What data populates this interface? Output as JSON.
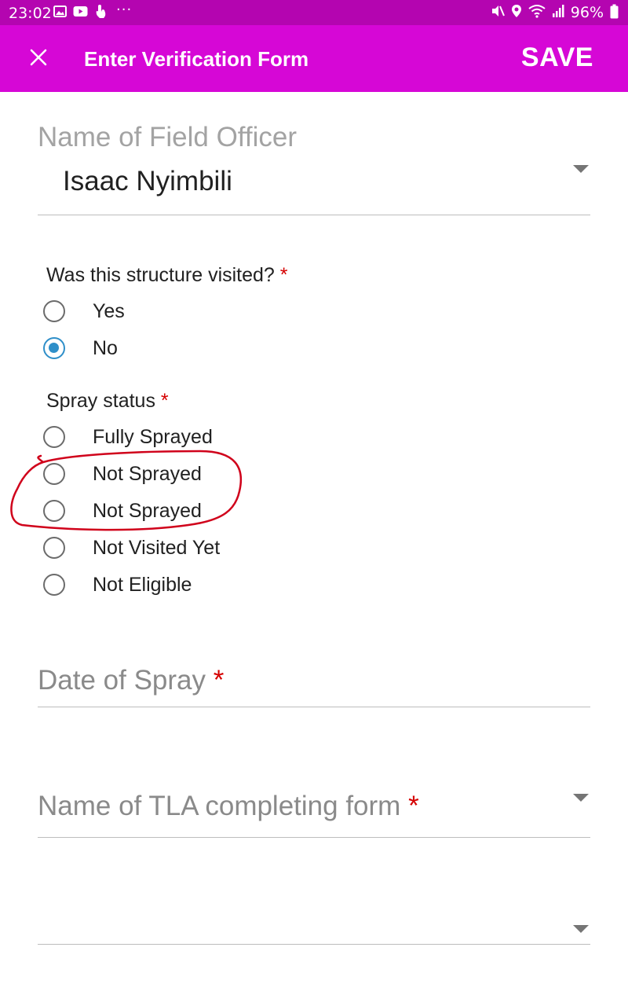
{
  "status_bar": {
    "time": "23:02",
    "more_indicator": "···",
    "battery": "96%",
    "left_icons": [
      "image-icon",
      "youtube-icon",
      "touch-icon"
    ],
    "right_icons": [
      "mute-icon",
      "location-icon",
      "wifi-icon",
      "signal-icon",
      "battery-icon"
    ]
  },
  "app_bar": {
    "title": "Enter Verification Form",
    "save_label": "SAVE",
    "close_icon": "close-icon",
    "color": "#d607d6"
  },
  "form": {
    "field_officer": {
      "label": "Name of Field Officer",
      "value": "Isaac Nyimbili"
    },
    "visited": {
      "question": "Was this structure visited?",
      "required_mark": "*",
      "options": [
        {
          "label": "Yes",
          "checked": false
        },
        {
          "label": "No",
          "checked": true
        }
      ]
    },
    "spray_status": {
      "question": "Spray status",
      "required_mark": "*",
      "options": [
        {
          "label": "Fully Sprayed",
          "checked": false
        },
        {
          "label": "Not Sprayed",
          "checked": false
        },
        {
          "label": "Not Sprayed",
          "checked": false
        },
        {
          "label": "Not Visited Yet",
          "checked": false
        },
        {
          "label": "Not Eligible",
          "checked": false
        }
      ]
    },
    "date_of_spray": {
      "label": "Date of Spray",
      "required_mark": "*"
    },
    "tla_name": {
      "label": "Name of TLA completing form",
      "required_mark": "*"
    },
    "extra_dropdown": {
      "value": ""
    }
  },
  "colors": {
    "status_bar": "#b405b0",
    "app_bar": "#d607d6",
    "radio_selected": "#2f8fc9",
    "required": "#d50000",
    "annotation": "#d0021b"
  }
}
